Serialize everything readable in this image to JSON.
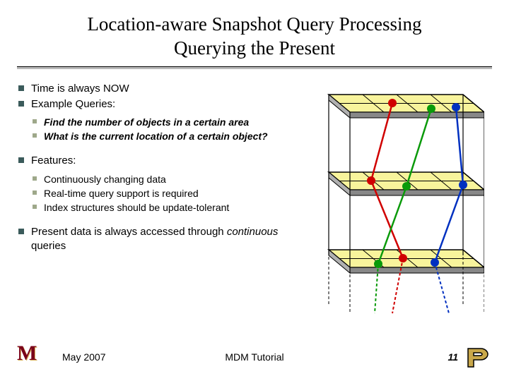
{
  "title": {
    "line1": "Location-aware Snapshot Query Processing",
    "line2": "Querying the Present"
  },
  "bullets": {
    "b1": "Time is always NOW",
    "b2": "Example Queries:",
    "b2_sub1": "Find the number of objects in a certain area",
    "b2_sub2": "What is the current location of a certain object?",
    "b3": "Features:",
    "b3_sub1": "Continuously changing data",
    "b3_sub2": "Real-time query support is required",
    "b3_sub3": "Index structures should be update-tolerant",
    "b4_pre": "Present data is always accessed through ",
    "b4_em": "continuous",
    "b4_post": " queries"
  },
  "footer": {
    "date": "May 2007",
    "center": "MDM Tutorial",
    "page": "11"
  }
}
